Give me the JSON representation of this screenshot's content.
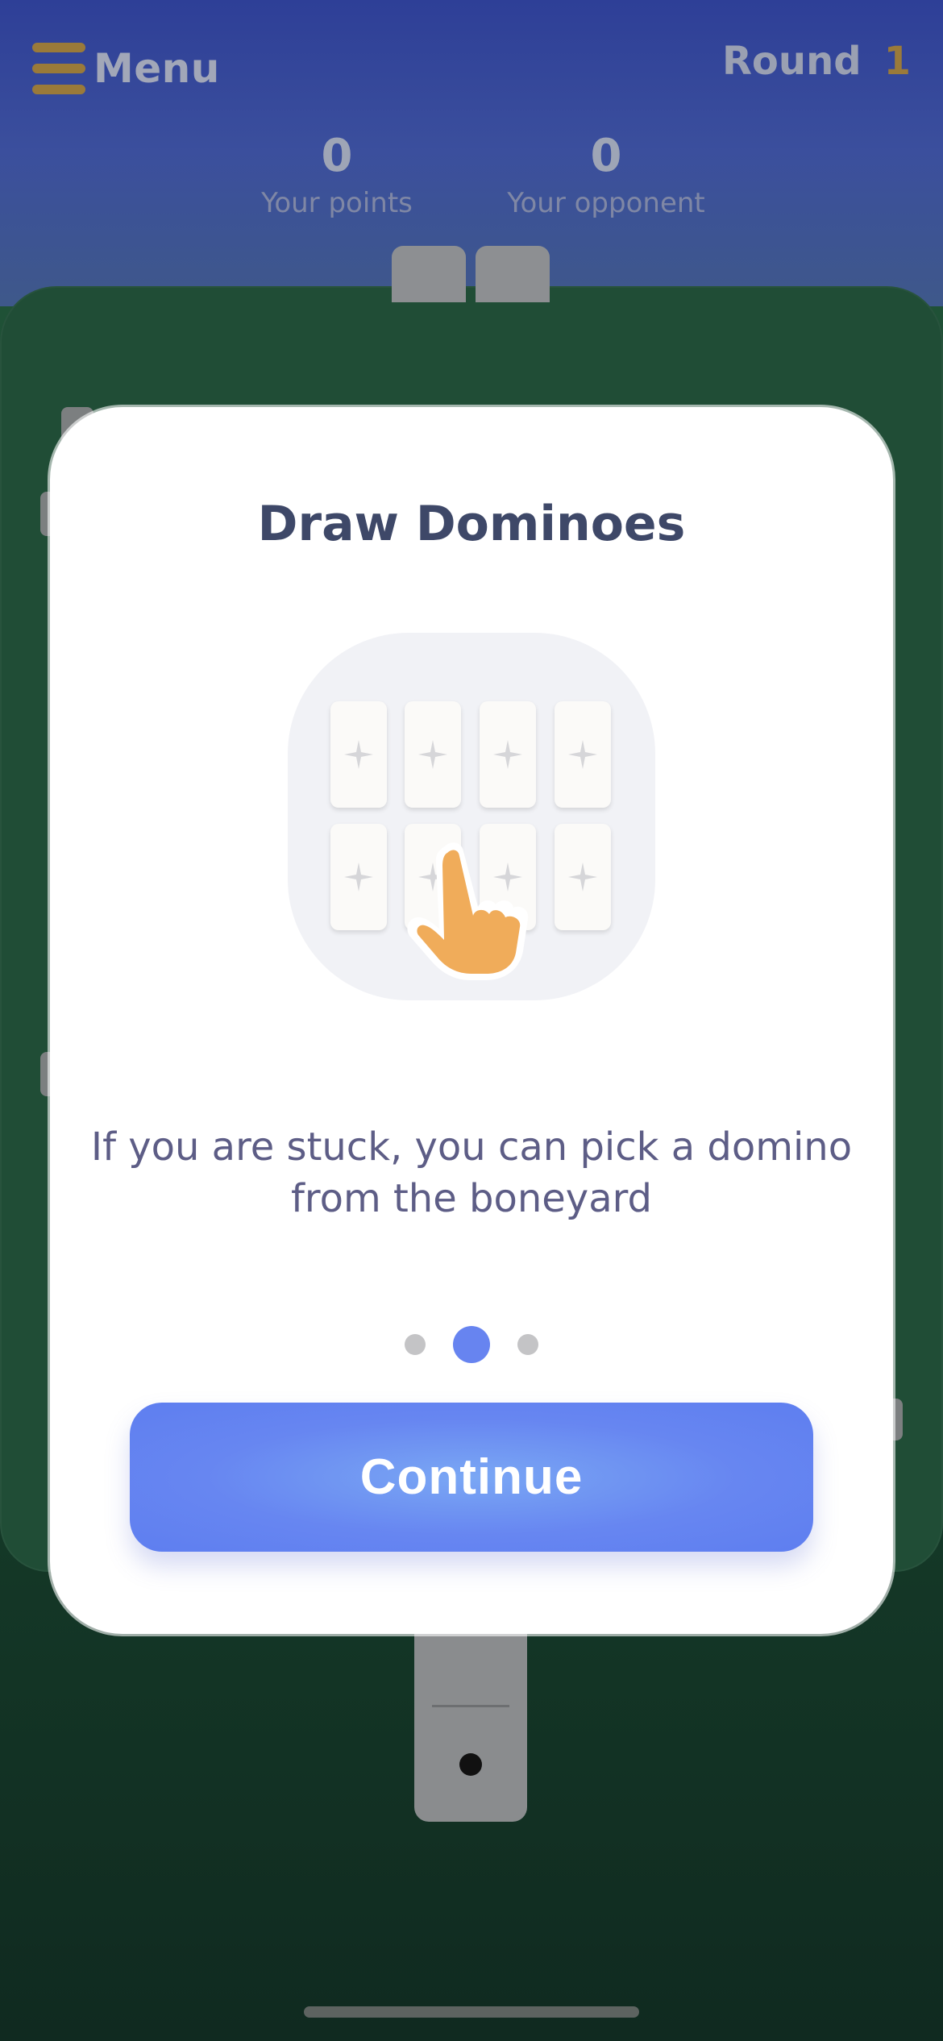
{
  "header": {
    "menu_label": "Menu",
    "round_label": "Round",
    "round_number": "1"
  },
  "scores": {
    "you": {
      "value": "0",
      "caption": "Your points"
    },
    "opponent": {
      "value": "0",
      "caption": "Your opponent"
    }
  },
  "modal": {
    "title": "Draw Dominoes",
    "description_line1": "If you are stuck, you can pick a domino",
    "description_line2": "from the boneyard",
    "pagination": {
      "total": 3,
      "active_index": 1
    },
    "continue_label": "Continue"
  },
  "colors": {
    "accent_blue": "#6784f0",
    "menu_gold": "#9a7a3a",
    "table_green": "#204d36",
    "hand_orange": "#f0ac5a"
  },
  "icons": {
    "menu": "hamburger-icon",
    "tile_mark": "sparkle-icon",
    "pointer": "hand-pointer-icon"
  }
}
